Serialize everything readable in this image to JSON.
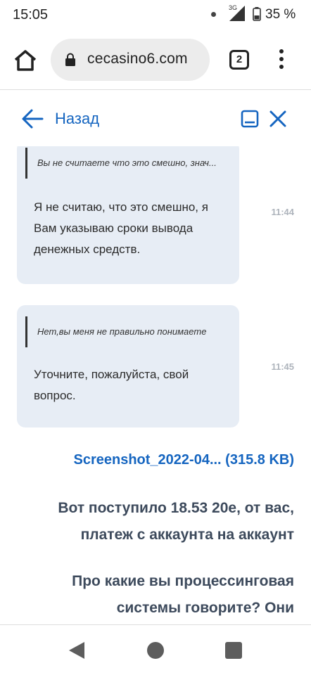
{
  "status_bar": {
    "time": "15:05",
    "network": "3G",
    "battery": "35 %"
  },
  "browser": {
    "url": "cecasino6.com",
    "tab_count": "2",
    "icons": [
      "home-icon",
      "lock-icon",
      "tabs-icon",
      "more-vert-icon"
    ]
  },
  "chat_header": {
    "back_label": "Назад",
    "icons": [
      "arrow-back-icon",
      "minimize-icon",
      "close-icon"
    ],
    "accent_color": "#1565c0"
  },
  "messages": [
    {
      "quote": "Вы не считаете что это смешно, знач...",
      "lines": [
        "Я не считаю, что это смешно, я",
        "Вам указываю сроки вывода",
        "денежных средств."
      ],
      "time": "11:44"
    },
    {
      "quote": "Нет,вы меня не правильно понимаете",
      "lines": [
        "Уточните, пожалуйста, свой",
        "вопрос."
      ],
      "time": "11:45"
    }
  ],
  "attachment": {
    "label": "Screenshot_2022-04... (315.8 KB)"
  },
  "outgoing": [
    {
      "lines": [
        "Вот поступило 18.53 20е, от вас,",
        "платеж с аккаунта на аккаунт"
      ]
    },
    {
      "lines": [
        "Про какие вы процессинговая",
        "системы говорите? Они"
      ]
    }
  ],
  "nav_bar": {
    "icons": [
      "nav-back-icon",
      "nav-home-icon",
      "nav-recents-icon"
    ]
  }
}
